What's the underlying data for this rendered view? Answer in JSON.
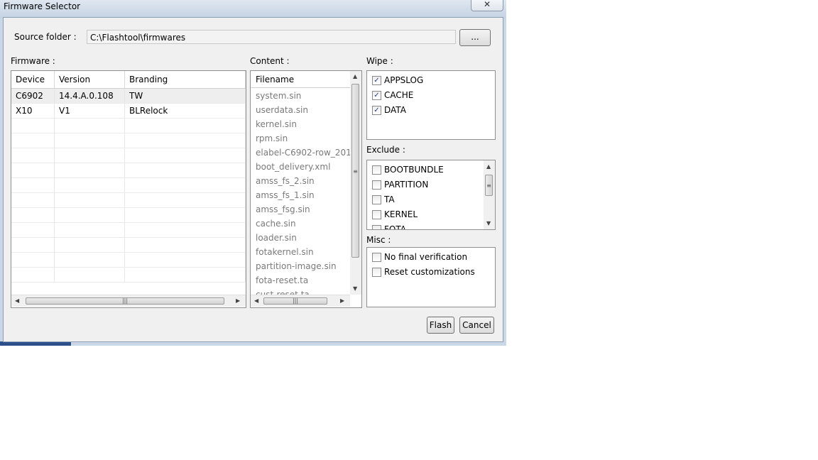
{
  "window": {
    "title": "Firmware Selector",
    "close_glyph": "✕"
  },
  "source": {
    "label": "Source folder :",
    "path": "C:\\Flashtool\\firmwares",
    "browse_label": "..."
  },
  "firmware": {
    "label": "Firmware :",
    "columns": [
      "Device",
      "Version",
      "Branding"
    ],
    "rows": [
      {
        "device": "C6902",
        "version": "14.4.A.0.108",
        "branding": "TW"
      },
      {
        "device": "X10",
        "version": "V1",
        "branding": "BLRelock"
      }
    ]
  },
  "content": {
    "label": "Content :",
    "header": "Filename",
    "files": [
      "system.sin",
      "userdata.sin",
      "kernel.sin",
      "rpm.sin",
      "elabel-C6902-row_201...",
      "boot_delivery.xml",
      "amss_fs_2.sin",
      "amss_fs_1.sin",
      "amss_fsg.sin",
      "cache.sin",
      "loader.sin",
      "fotakernel.sin",
      "partition-image.sin",
      "fota-reset.ta",
      "cust-reset.ta"
    ]
  },
  "wipe": {
    "label": "Wipe :",
    "items": [
      {
        "label": "APPSLOG",
        "checked": true
      },
      {
        "label": "CACHE",
        "checked": true
      },
      {
        "label": "DATA",
        "checked": true
      }
    ]
  },
  "exclude": {
    "label": "Exclude :",
    "items": [
      {
        "label": "BOOTBUNDLE",
        "checked": false
      },
      {
        "label": "PARTITION",
        "checked": false
      },
      {
        "label": "TA",
        "checked": false
      },
      {
        "label": "KERNEL",
        "checked": false
      },
      {
        "label": "FOTA",
        "checked": false
      }
    ]
  },
  "misc": {
    "label": "Misc :",
    "items": [
      {
        "label": "No final verification",
        "checked": false
      },
      {
        "label": "Reset customizations",
        "checked": false
      }
    ]
  },
  "buttons": {
    "flash": "Flash",
    "cancel": "Cancel"
  },
  "icons": {
    "scroll_left": "left-arrow-icon",
    "scroll_right": "right-arrow-icon",
    "scroll_up": "up-arrow-icon",
    "scroll_down": "down-arrow-icon"
  }
}
